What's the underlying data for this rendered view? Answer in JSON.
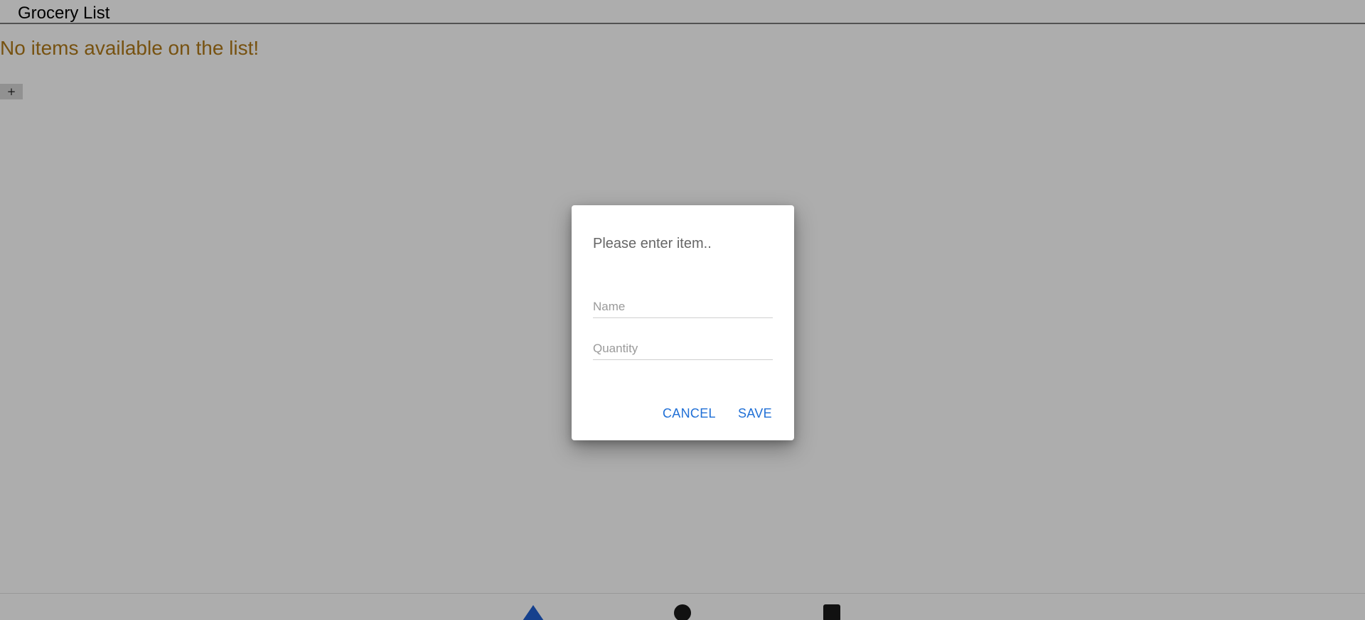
{
  "app": {
    "title": "Grocery List"
  },
  "main": {
    "empty_message": "No items available on the list!",
    "add_button_label": "+"
  },
  "dialog": {
    "title": "Please enter item..",
    "name_placeholder": "Name",
    "name_value": "",
    "quantity_placeholder": "Quantity",
    "quantity_value": "",
    "cancel_label": "CANCEL",
    "save_label": "SAVE"
  },
  "nav": {
    "back_icon": "triangle-back-icon",
    "home_icon": "circle-home-icon",
    "recents_icon": "square-recents-icon"
  },
  "colors": {
    "empty_message": "#b07a1a",
    "accent": "#1f6fd6",
    "nav_back": "#1f5fd0",
    "nav_icons": "#1a1a1a",
    "nav_background": "#ffffff"
  }
}
